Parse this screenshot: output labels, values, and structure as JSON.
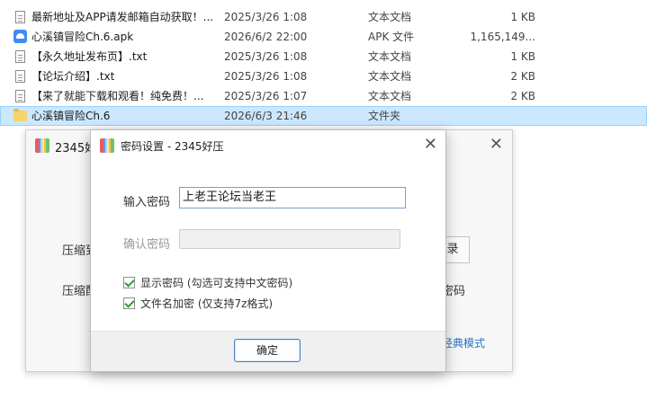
{
  "files": [
    {
      "name": "最新地址及APP请发邮箱自动获取！...",
      "date": "2025/3/26 1:08",
      "type": "文本文档",
      "size": "1 KB",
      "icon": "text-file-icon"
    },
    {
      "name": "心溪镇冒险Ch.6.apk",
      "date": "2026/6/2 22:00",
      "type": "APK 文件",
      "size": "1,165,149...",
      "icon": "apk-file-icon"
    },
    {
      "name": "【永久地址发布页】.txt",
      "date": "2025/3/26 1:08",
      "type": "文本文档",
      "size": "1 KB",
      "icon": "text-file-icon"
    },
    {
      "name": "【论坛介绍】.txt",
      "date": "2025/3/26 1:08",
      "type": "文本文档",
      "size": "2 KB",
      "icon": "text-file-icon"
    },
    {
      "name": "【来了就能下载和观看！纯免费！...",
      "date": "2025/3/26 1:07",
      "type": "文本文档",
      "size": "2 KB",
      "icon": "text-file-icon"
    },
    {
      "name": "心溪镇冒险Ch.6",
      "date": "2026/6/3 21:46",
      "type": "文件夹",
      "size": "",
      "icon": "folder-icon"
    }
  ],
  "bg_window": {
    "title": "2345好",
    "close": "✕",
    "label1": "压缩到",
    "label2": "压缩配",
    "button_right": "录",
    "text_right": "密码",
    "classic_link": "经典模式"
  },
  "dialog": {
    "title": "密码设置 - 2345好压",
    "close": "✕",
    "password_label": "输入密码",
    "password_value": "上老王论坛当老王",
    "confirm_label": "确认密码",
    "confirm_value": "",
    "show_password_label": "显示密码 (勾选可支持中文密码)",
    "encrypt_names_label": "文件名加密 (仅支持7z格式)",
    "ok_label": "确定"
  },
  "colors": {
    "selection": "#cce8ff",
    "accent": "#4a7fc7",
    "check": "#2e9c2e"
  }
}
